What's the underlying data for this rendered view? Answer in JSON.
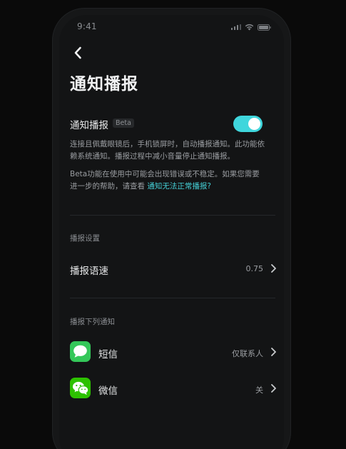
{
  "status_bar": {
    "time": "9:41"
  },
  "header": {
    "back_icon": "chevron-left-icon",
    "title": "通知播报"
  },
  "feature": {
    "label": "通知播报",
    "badge": "Beta",
    "toggle_on": true,
    "accent_color": "#3fd6dc",
    "description": "连接且佩戴眼镜后，手机锁屏时，自动播报通知。此功能依赖系统通知。播报过程中减小音量停止通知播报。",
    "beta_note": "Beta功能在使用中可能会出现错误或不稳定。如果您需要进一步的帮助，请查看 ",
    "help_link": "通知无法正常播报?"
  },
  "broadcast_settings": {
    "header": "播报设置",
    "speed": {
      "label": "播报语速",
      "value": "0.75"
    }
  },
  "notify_apps": {
    "header": "播报下列通知",
    "items": [
      {
        "label": "短信",
        "value": "仅联系人",
        "icon": "sms-message-icon"
      },
      {
        "label": "微信",
        "value": "关",
        "icon": "wechat-icon"
      }
    ]
  }
}
